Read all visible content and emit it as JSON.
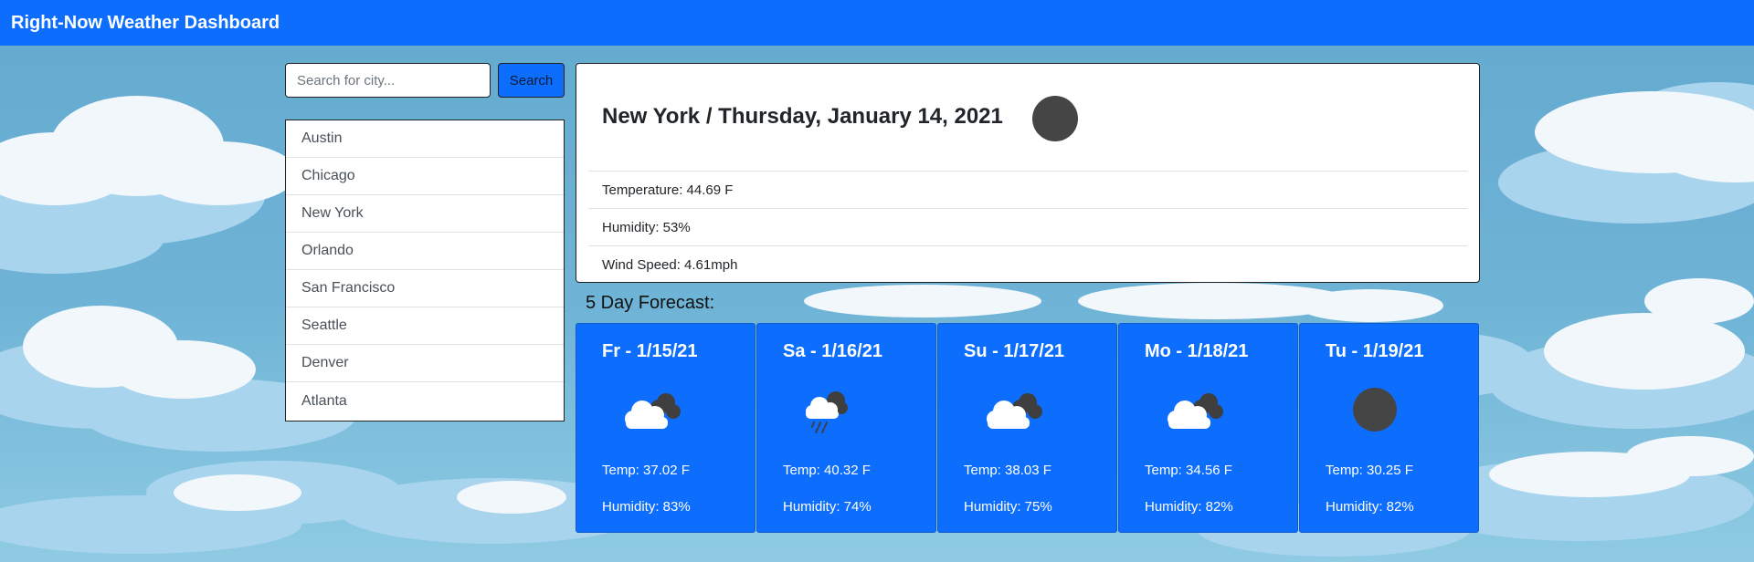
{
  "header": {
    "title": "Right-Now Weather Dashboard"
  },
  "search": {
    "placeholder": "Search for city...",
    "button_label": "Search"
  },
  "cities": [
    "Austin",
    "Chicago",
    "New York",
    "Orlando",
    "San Francisco",
    "Seattle",
    "Denver",
    "Atlanta"
  ],
  "current": {
    "title": "New York / Thursday, January 14, 2021",
    "icon": "dark-circle-icon",
    "temperature": "Temperature: 44.69 F",
    "humidity": "Humidity: 53%",
    "wind": "Wind Speed: 4.61mph"
  },
  "forecast": {
    "heading": "5 Day Forecast:",
    "days": [
      {
        "date": "Fr - 1/15/21",
        "icon": "cloudy-icon",
        "temp": "Temp: 37.02 F",
        "humidity": "Humidity: 83%"
      },
      {
        "date": "Sa - 1/16/21",
        "icon": "rain-icon",
        "temp": "Temp: 40.32 F",
        "humidity": "Humidity: 74%"
      },
      {
        "date": "Su - 1/17/21",
        "icon": "cloudy-icon",
        "temp": "Temp: 38.03 F",
        "humidity": "Humidity: 75%"
      },
      {
        "date": "Mo - 1/18/21",
        "icon": "cloudy-icon",
        "temp": "Temp: 34.56 F",
        "humidity": "Humidity: 82%"
      },
      {
        "date": "Tu - 1/19/21",
        "icon": "dark-circle-icon",
        "temp": "Temp: 30.25 F",
        "humidity": "Humidity: 82%"
      }
    ]
  },
  "colors": {
    "primary": "#0d6efd",
    "sky": "#6fb4d6",
    "cloud_light": "#f2f7fb",
    "cloud_blue": "#a9d4ee",
    "icon_dark": "#454545"
  }
}
